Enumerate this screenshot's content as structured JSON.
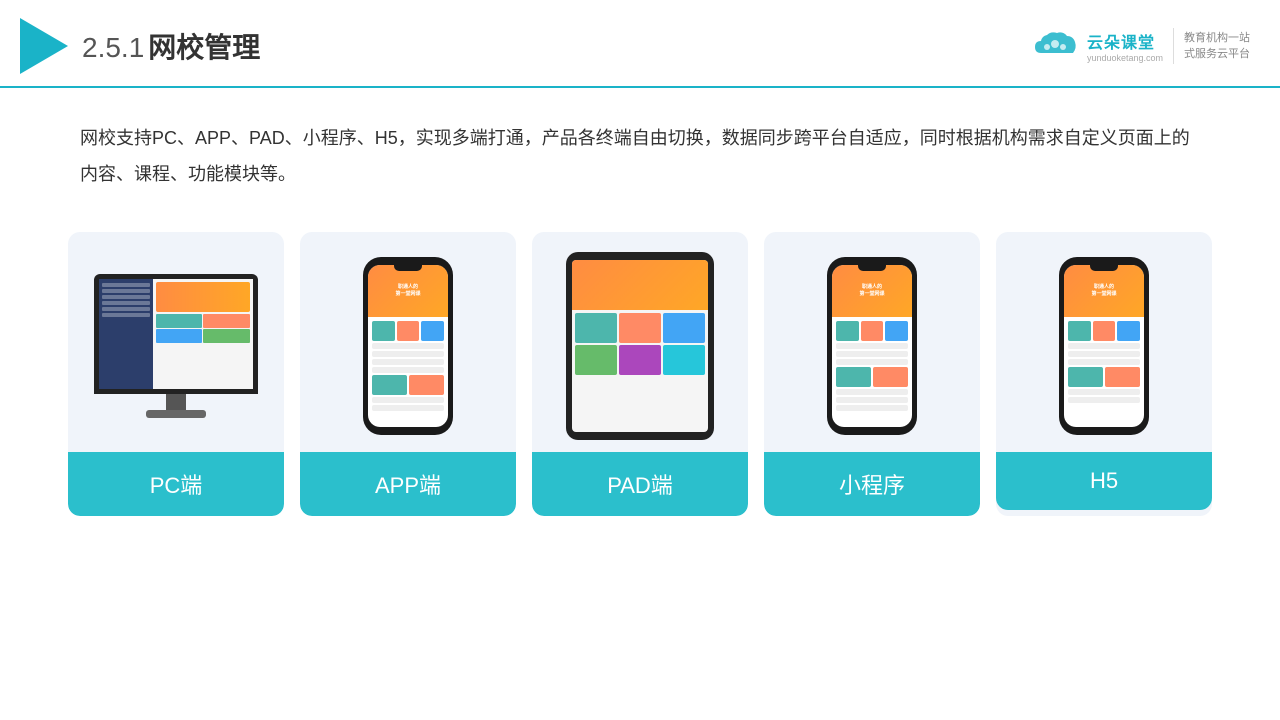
{
  "header": {
    "title_number": "2.5.1",
    "title_main": "网校管理",
    "brand_name": "云朵课堂",
    "brand_domain": "yunduoketang.com",
    "brand_service": "教育机构一站\n式服务云平台"
  },
  "description": {
    "text": "网校支持PC、APP、PAD、小程序、H5，实现多端打通，产品各终端自由切换，数据同步跨平台自适应，同时根据机构需求自定义页面上的内容、课程、功能模块等。"
  },
  "cards": [
    {
      "id": "pc",
      "label": "PC端"
    },
    {
      "id": "app",
      "label": "APP端"
    },
    {
      "id": "pad",
      "label": "PAD端"
    },
    {
      "id": "miniprogram",
      "label": "小程序"
    },
    {
      "id": "h5",
      "label": "H5"
    }
  ]
}
